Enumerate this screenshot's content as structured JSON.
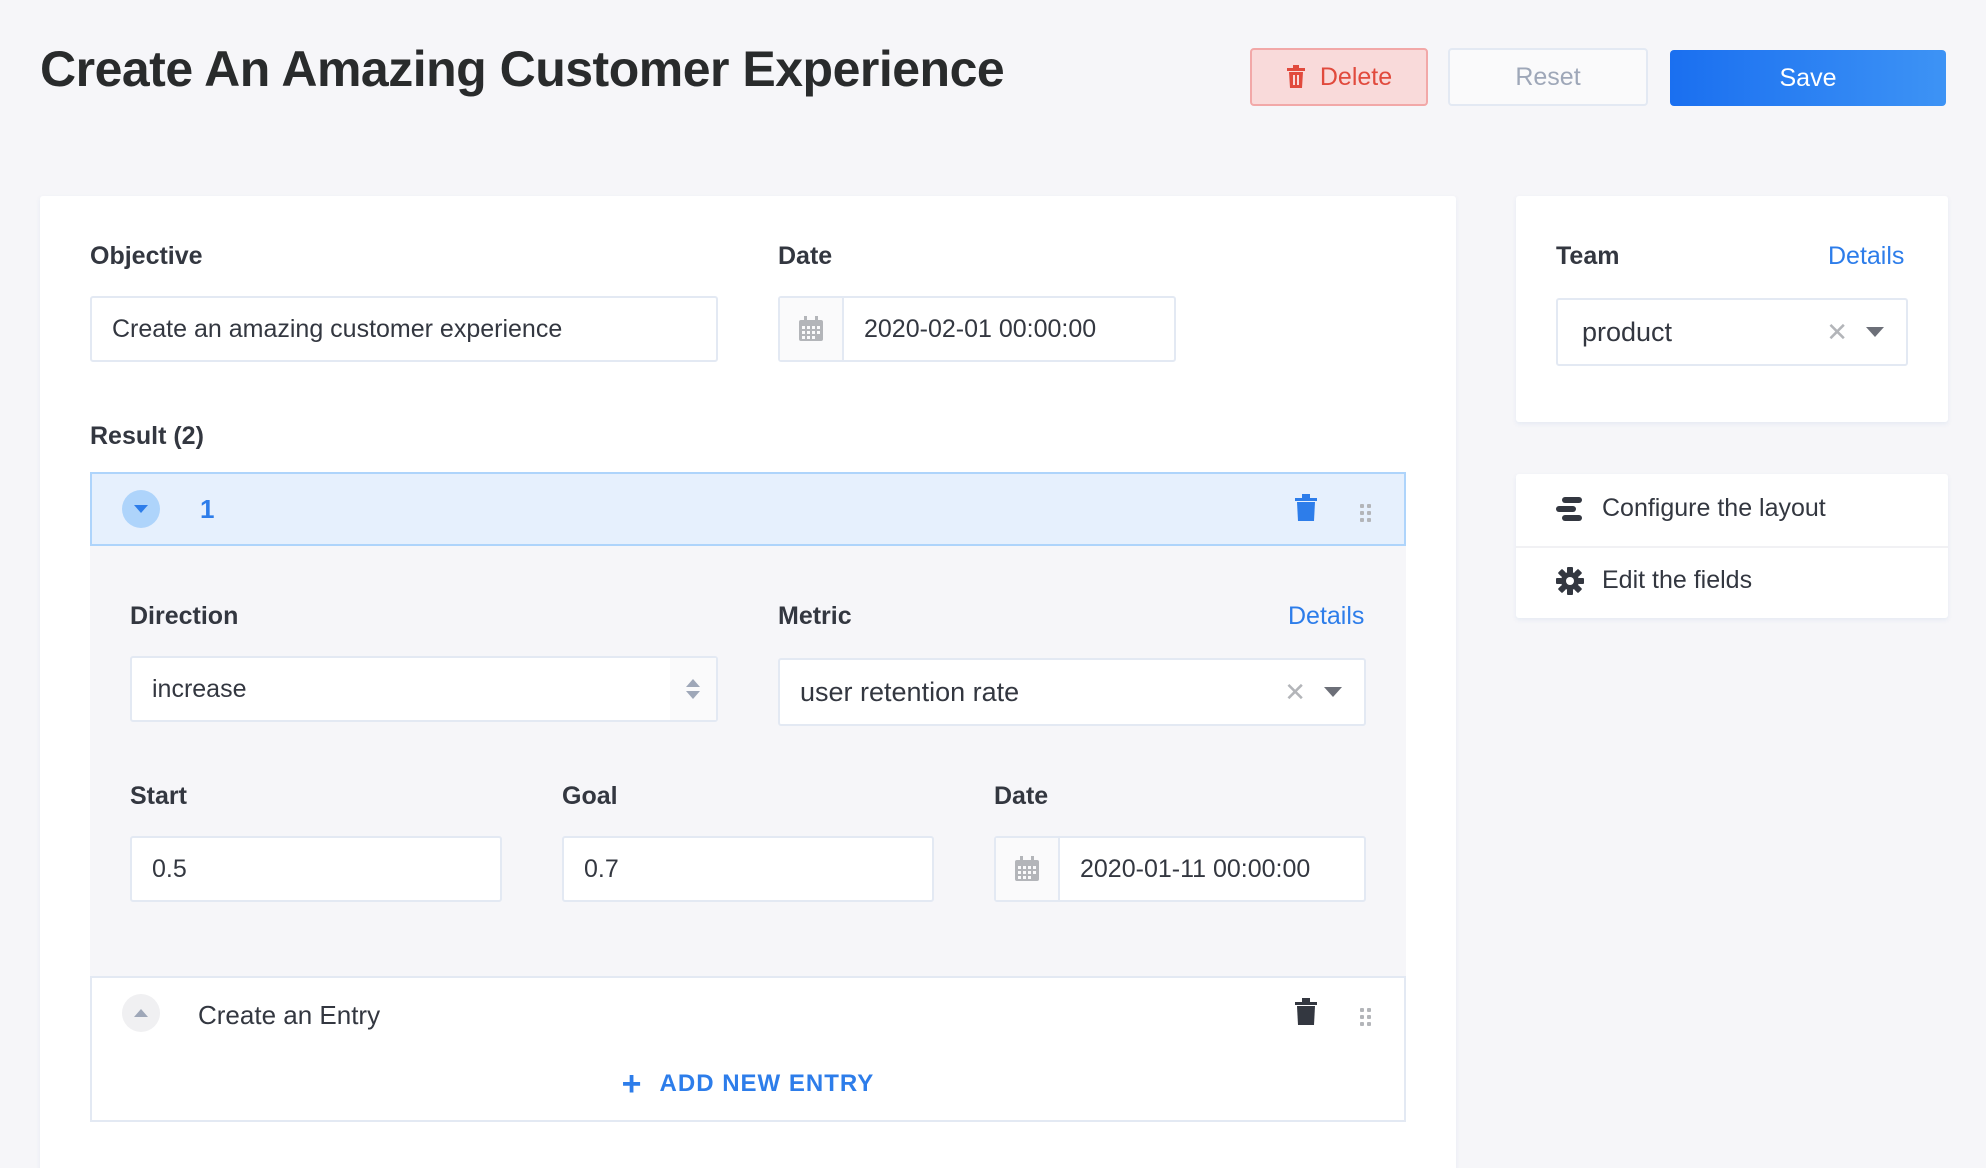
{
  "header": {
    "title": "Create An Amazing Customer Experience",
    "delete_label": "Delete",
    "reset_label": "Reset",
    "save_label": "Save"
  },
  "form": {
    "objective": {
      "label": "Objective",
      "value": "Create an amazing customer experience"
    },
    "date": {
      "label": "Date",
      "value": "2020-02-01 00:00:00"
    },
    "results": {
      "label": "Result (2)",
      "item": {
        "index": "1",
        "direction": {
          "label": "Direction",
          "value": "increase"
        },
        "metric": {
          "label": "Metric",
          "details_link": "Details",
          "value": "user retention rate"
        },
        "start": {
          "label": "Start",
          "value": "0.5"
        },
        "goal": {
          "label": "Goal",
          "value": "0.7"
        },
        "date": {
          "label": "Date",
          "value": "2020-01-11 00:00:00"
        }
      },
      "entry_title": "Create an Entry",
      "add_entry_label": "ADD NEW ENTRY"
    }
  },
  "sidebar": {
    "team": {
      "label": "Team",
      "details_link": "Details",
      "value": "product"
    },
    "links": [
      {
        "label": "Configure the layout",
        "icon": "layout-icon"
      },
      {
        "label": "Edit the fields",
        "icon": "gear-icon"
      }
    ]
  },
  "colors": {
    "primary": "#2d7dea",
    "danger": "#e14a3d",
    "background": "#f6f6f9"
  }
}
